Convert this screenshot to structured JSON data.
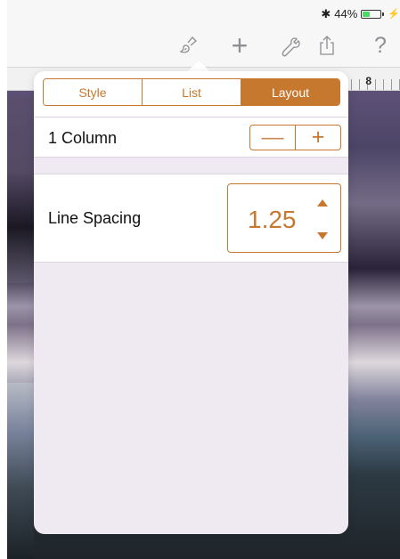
{
  "status_bar": {
    "bluetooth_icon": "bluetooth-icon",
    "battery_percent": "44%",
    "battery_level": 0.44,
    "charging_icon": "charging-icon"
  },
  "toolbar": {
    "format_icon": "paintbrush-icon",
    "insert_label": "+",
    "tools_icon": "wrench-icon",
    "share_icon": "share-icon",
    "help_label": "?"
  },
  "ruler": {
    "mark": "8"
  },
  "popover": {
    "tabs": [
      {
        "label": "Style",
        "active": false
      },
      {
        "label": "List",
        "active": false
      },
      {
        "label": "Layout",
        "active": true
      }
    ],
    "columns": {
      "label": "1 Column",
      "decrement": "—",
      "increment": "+"
    },
    "line_spacing": {
      "label": "Line Spacing",
      "value": "1.25"
    }
  },
  "colors": {
    "accent": "#c6782f",
    "popover_bg": "#efe9f1",
    "battery": "#4cd964"
  }
}
